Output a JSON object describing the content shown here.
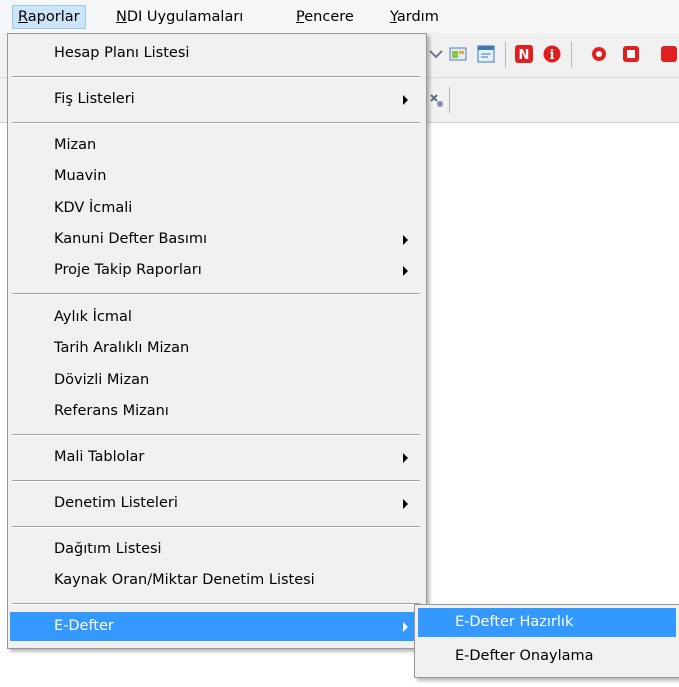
{
  "menubar": {
    "items": [
      {
        "accel": "R",
        "rest": "aporlar"
      },
      {
        "accel": "N",
        "rest": "DI Uygulamaları"
      },
      {
        "accel": "P",
        "rest": "encere"
      },
      {
        "accel": "Y",
        "rest": "ardım"
      }
    ]
  },
  "raporlar_menu": {
    "items": [
      "Hesap Planı Listesi",
      "Fiş Listeleri",
      "Mizan",
      "Muavin",
      "KDV İcmali",
      "Kanuni Defter Basımı",
      "Proje Takip Raporları",
      "Aylık İcmal",
      "Tarih Aralıklı Mizan",
      "Dövizli Mizan",
      "Referans Mizanı",
      "Mali Tablolar",
      "Denetim Listeleri",
      "Dağıtım Listesi",
      "Kaynak Oran/Miktar Denetim Listesi",
      "E-Defter"
    ]
  },
  "edefter_submenu": {
    "items": [
      "E-Defter Hazırlık",
      "E-Defter Onaylama"
    ]
  },
  "colors": {
    "highlight": "#3399ff",
    "menu_bg": "#f0f0f0",
    "toolbar_red": "#e02020"
  }
}
